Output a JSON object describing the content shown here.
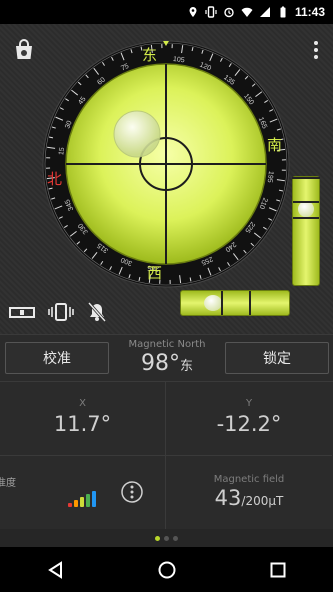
{
  "status": {
    "time": "11:43"
  },
  "compass": {
    "cardinals": {
      "east": "东",
      "south": "南",
      "west": "西",
      "north": "北"
    },
    "tick_labels": [
      "105",
      "120",
      "135",
      "150",
      "165",
      "195",
      "210",
      "225",
      "240",
      "255",
      "285",
      "300",
      "315",
      "330",
      "345",
      "15",
      "30",
      "45",
      "60",
      "75"
    ],
    "accent": "#d4ec4a"
  },
  "controls": {
    "calibrate_label": "校准",
    "lock_label": "锁定",
    "magnetic_north_label": "Magnetic North",
    "heading_value": "98°",
    "heading_dir": "东"
  },
  "readings": {
    "x_label": "X",
    "x_value": "11.7°",
    "y_label": "Y",
    "y_value": "-12.2°",
    "accuracy_label": "精准度",
    "field_label": "Magnetic field",
    "field_value": "43",
    "field_unit": "/200μT"
  },
  "pager": {
    "pages": 3,
    "active": 0
  },
  "colors": {
    "bars": [
      "#e53935",
      "#ff9800",
      "#cddc39",
      "#4caf50",
      "#2196f3"
    ]
  }
}
